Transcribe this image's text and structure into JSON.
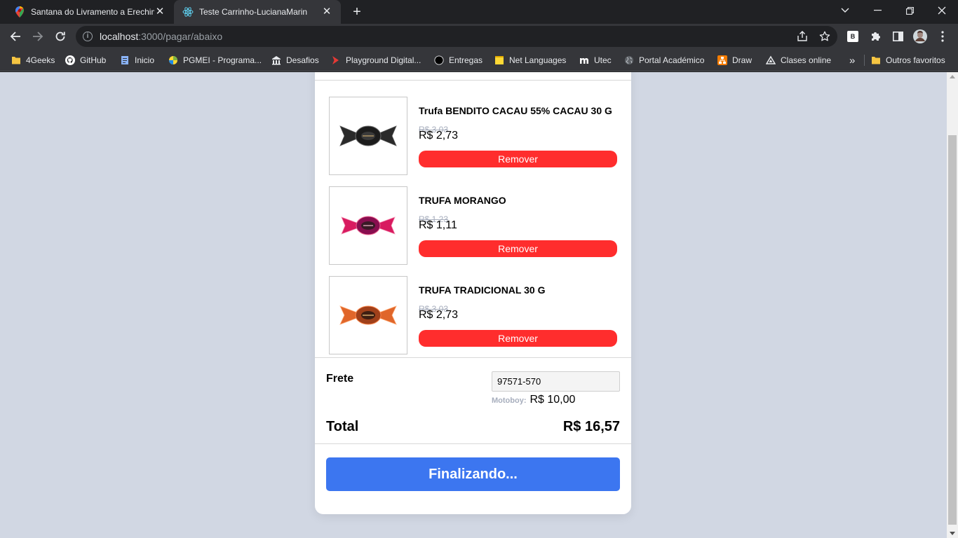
{
  "browser": {
    "tabs": [
      {
        "title": "Santana do Livramento a Erechim",
        "icon": "maps-pin-icon",
        "active": false
      },
      {
        "title": "Teste Carrinho-LucianaMarin",
        "icon": "react-icon",
        "active": true
      }
    ],
    "url": {
      "host": "localhost",
      "rest": ":3000/pagar/abaixo"
    },
    "profile_badge": "B"
  },
  "bookmarks": [
    {
      "label": "4Geeks",
      "icon": "folder-icon",
      "color": "#f5c542"
    },
    {
      "label": "GitHub",
      "icon": "github-icon",
      "color": "#ffffff"
    },
    {
      "label": "Inicio",
      "icon": "doc-icon",
      "color": "#8ab4f8"
    },
    {
      "label": "PGMEI - Programa...",
      "icon": "pgmei-icon",
      "color": "#7cb342"
    },
    {
      "label": "Desafios",
      "icon": "building-icon",
      "color": "#e8eaed"
    },
    {
      "label": "Playground Digital...",
      "icon": "chevron-red-icon",
      "color": "#e53935"
    },
    {
      "label": "Entregas",
      "icon": "circle-icon",
      "color": "#000000"
    },
    {
      "label": "Net Languages",
      "icon": "note-icon",
      "color": "#fdd835"
    },
    {
      "label": "Utec",
      "icon": "utec-icon",
      "color": "#ffffff"
    },
    {
      "label": "Portal Académico",
      "icon": "globe-icon",
      "color": "#9aa0a6"
    },
    {
      "label": "Draw",
      "icon": "draw-icon",
      "color": "#f57c00"
    },
    {
      "label": "Clases online",
      "icon": "triangle-icon",
      "color": "#e8eaed"
    }
  ],
  "bookmarks_overflow": "»",
  "other_bookmarks": "Outros favoritos",
  "cart": {
    "items": [
      {
        "name": "Trufa BENDITO CACAU 55% CACAU 30 G",
        "old_price": "R$ 3,03",
        "price": "R$ 2,73",
        "remove_label": "Remover",
        "wrapper_color": "#2a2a2a"
      },
      {
        "name": "TRUFA MORANGO",
        "old_price": "R$ 1,23",
        "price": "R$ 1,11",
        "remove_label": "Remover",
        "wrapper_color": "#c2185b"
      },
      {
        "name": "TRUFA TRADICIONAL 30 G",
        "old_price": "R$ 3,03",
        "price": "R$ 2,73",
        "remove_label": "Remover",
        "wrapper_color": "#c1541f"
      }
    ],
    "shipping": {
      "label": "Frete",
      "cep": "97571-570",
      "method": "Motoboy:",
      "cost": "R$ 10,00"
    },
    "total_label": "Total",
    "total_value": "R$ 16,57",
    "finalize_label": "Finalizando..."
  },
  "colors": {
    "page_bg": "#d1d7e3",
    "remove_button": "#ff2d2d",
    "finalize_button": "#3c76f0"
  }
}
